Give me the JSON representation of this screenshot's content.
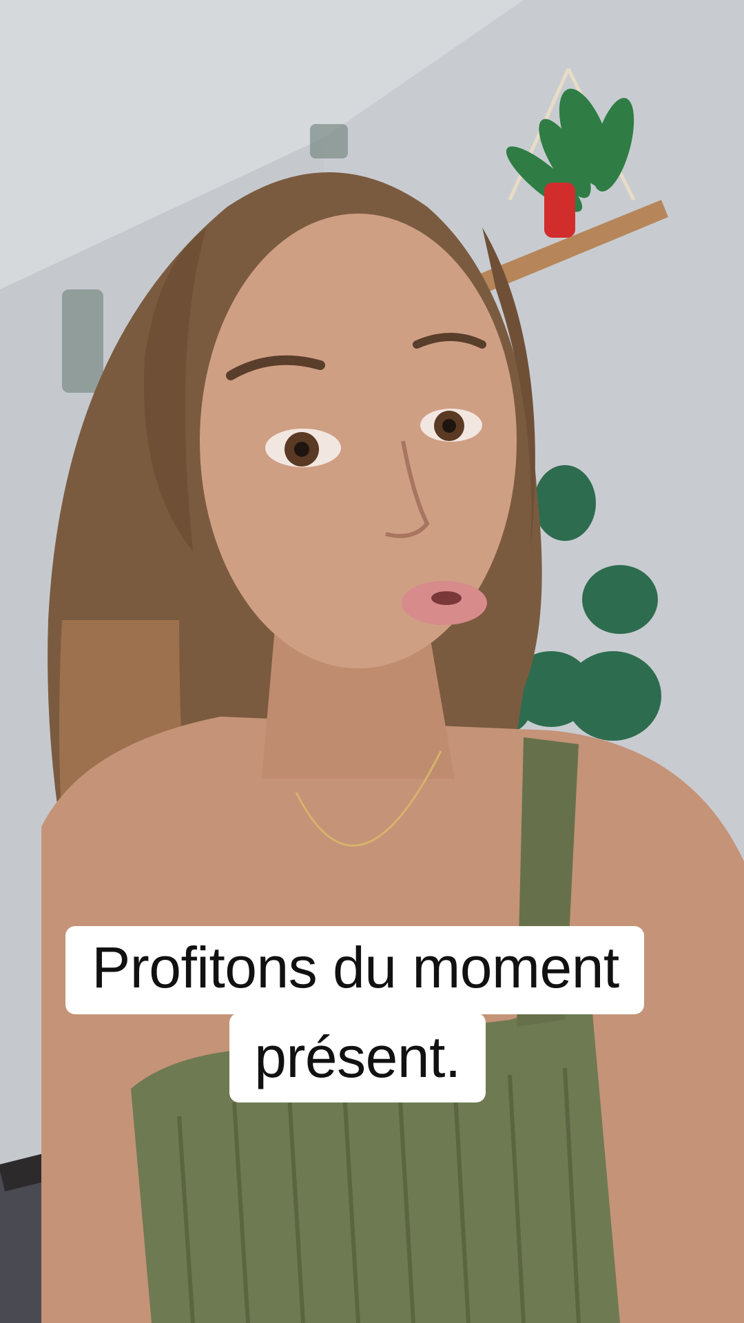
{
  "video": {
    "scene_description_icon": "person-selfie-video",
    "colors": {
      "wall": "#c9cdd1",
      "hair": "#7a5a3e",
      "skin": "#c99a80",
      "top": "#6f7a52",
      "plant": "#2f6e4c",
      "caption_bg": "#ffffff",
      "caption_text": "#111111"
    }
  },
  "caption": {
    "line1": "Profitons du moment",
    "line2": "présent."
  }
}
